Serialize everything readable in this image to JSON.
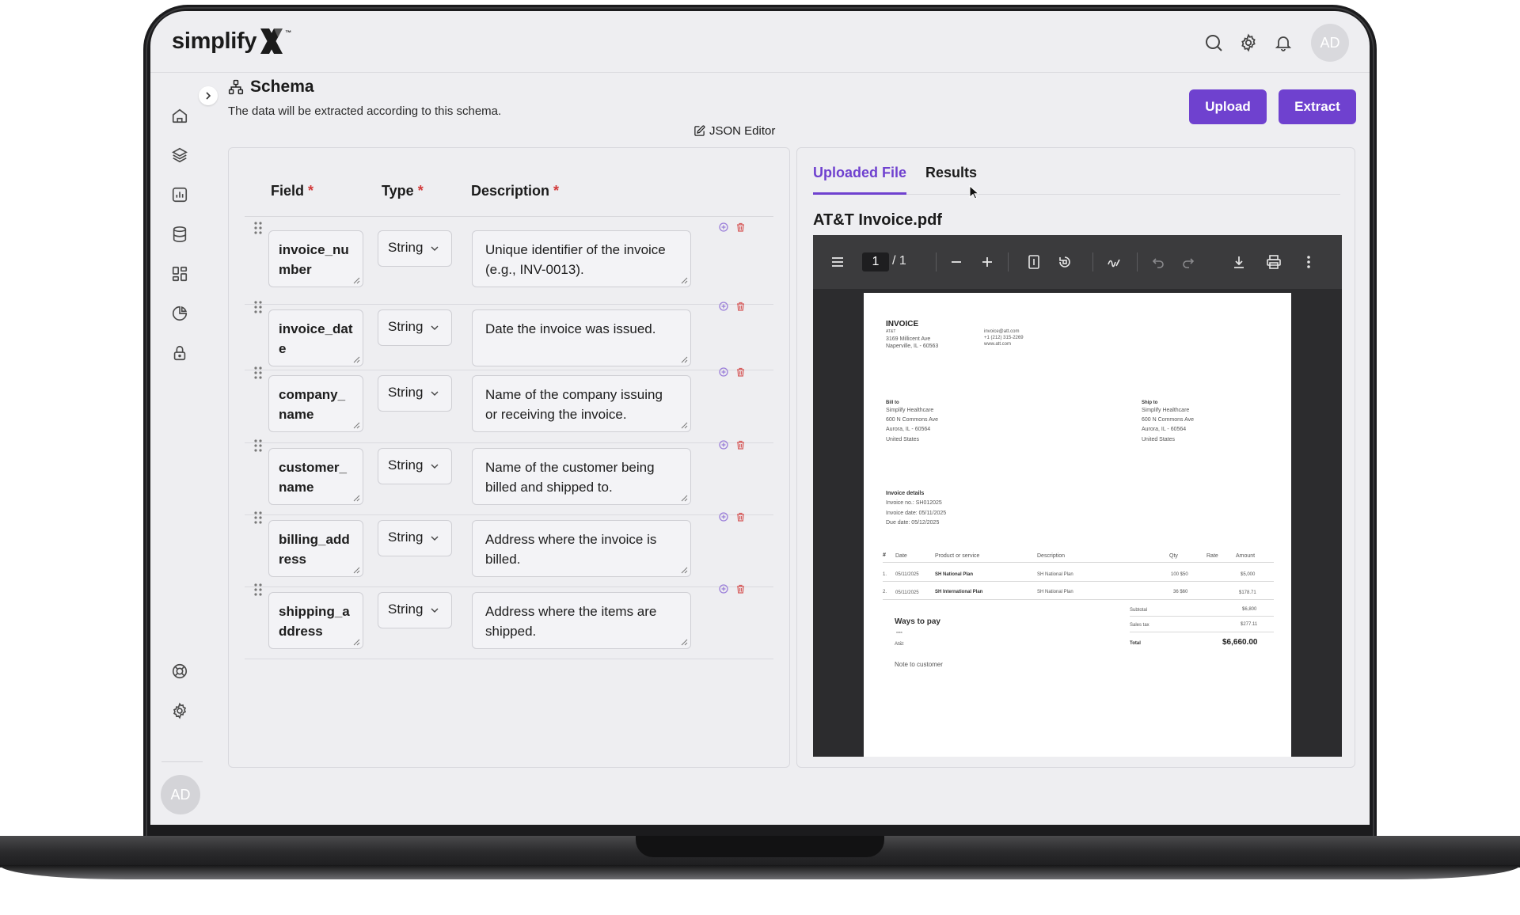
{
  "app": {
    "logo_text": "simplify",
    "logo_mark": "X",
    "logo_tm": "™",
    "avatar_initials": "AD"
  },
  "topbar": {
    "icons": [
      "search-icon",
      "gear-icon",
      "bell-icon"
    ]
  },
  "sidebar": {
    "items": [
      "home-icon",
      "layers-icon",
      "chart-icon",
      "database-icon",
      "dashboard-icon",
      "pie-chart-icon",
      "lock-icon"
    ],
    "bottom_items": [
      "help-icon",
      "settings-icon"
    ],
    "avatar_initials": "AD"
  },
  "header": {
    "title": "Schema",
    "subtitle": "The data will be extracted according to this schema.",
    "json_editor_label": "JSON Editor",
    "upload_label": "Upload",
    "extract_label": "Extract"
  },
  "schema": {
    "columns": {
      "field": "Field",
      "type": "Type",
      "description": "Description",
      "required_mark": "*"
    },
    "rows": [
      {
        "field": "invoice_number",
        "type": "String",
        "description": "Unique identifier of the invoice (e.g., INV-0013)."
      },
      {
        "field": "invoice_date",
        "type": "String",
        "description": "Date the invoice was issued."
      },
      {
        "field": "company_name",
        "type": "String",
        "description": "Name of the company issuing or receiving the invoice."
      },
      {
        "field": "customer_name",
        "type": "String",
        "description": "Name of the customer being billed and shipped to."
      },
      {
        "field": "billing_address",
        "type": "String",
        "description": "Address where the invoice is billed."
      },
      {
        "field": "shipping_address",
        "type": "String",
        "description": "Address where the items are shipped."
      }
    ]
  },
  "preview": {
    "tabs": [
      "Uploaded File",
      "Results"
    ],
    "active_tab": "Uploaded File",
    "file_name": "AT&T Invoice.pdf",
    "viewer": {
      "page_current": "1",
      "page_total": "/  1"
    },
    "document": {
      "title": "INVOICE",
      "company": "AT&T",
      "company_address_1": "3169 Millicent Ave",
      "company_address_2": "Naperville, IL - 60563",
      "email": "invoice@att.com",
      "phone": "+1 (212) 315-2269",
      "website": "www.att.com",
      "bill_to_label": "Bill to",
      "bill_to": [
        "Simplify Healthcare",
        "600 N Commons Ave",
        "Aurora, IL - 60564",
        "United States"
      ],
      "ship_to_label": "Ship to",
      "ship_to": [
        "Simplify Healthcare",
        "600 N Commons Ave",
        "Aurora, IL - 60564",
        "United States"
      ],
      "details_label": "Invoice details",
      "invoice_no": "Invoice no.: SH012025",
      "invoice_date": "Invoice date: 05/11/2025",
      "due_date": "Due date: 05/12/2025",
      "table_headers": [
        "#",
        "Date",
        "Product or service",
        "Description",
        "Qty",
        "Rate",
        "Amount"
      ],
      "line_items": [
        {
          "num": "1.",
          "date": "05/11/2025",
          "product": "SH National Plan",
          "description": "SH National Plan",
          "qty_rate": "100 $50",
          "amount": "$5,000"
        },
        {
          "num": "2.",
          "date": "05/11/2025",
          "product": "SH International Plan",
          "description": "SH National Plan",
          "qty_rate": "36 $60",
          "amount": "$178.71"
        }
      ],
      "subtotal_label": "Subtotal",
      "subtotal": "$6,800",
      "tax_label": "Sales tax",
      "tax": "$277.11",
      "total_label": "Total",
      "total": "$6,660.00",
      "ways_to_pay": "Ways to pay",
      "pay_mark": "****",
      "pay_name": "At&t",
      "note": "Note to customer"
    }
  },
  "colors": {
    "accent": "#6f41cf",
    "required": "#d23b3b",
    "background": "#eeeef1"
  }
}
